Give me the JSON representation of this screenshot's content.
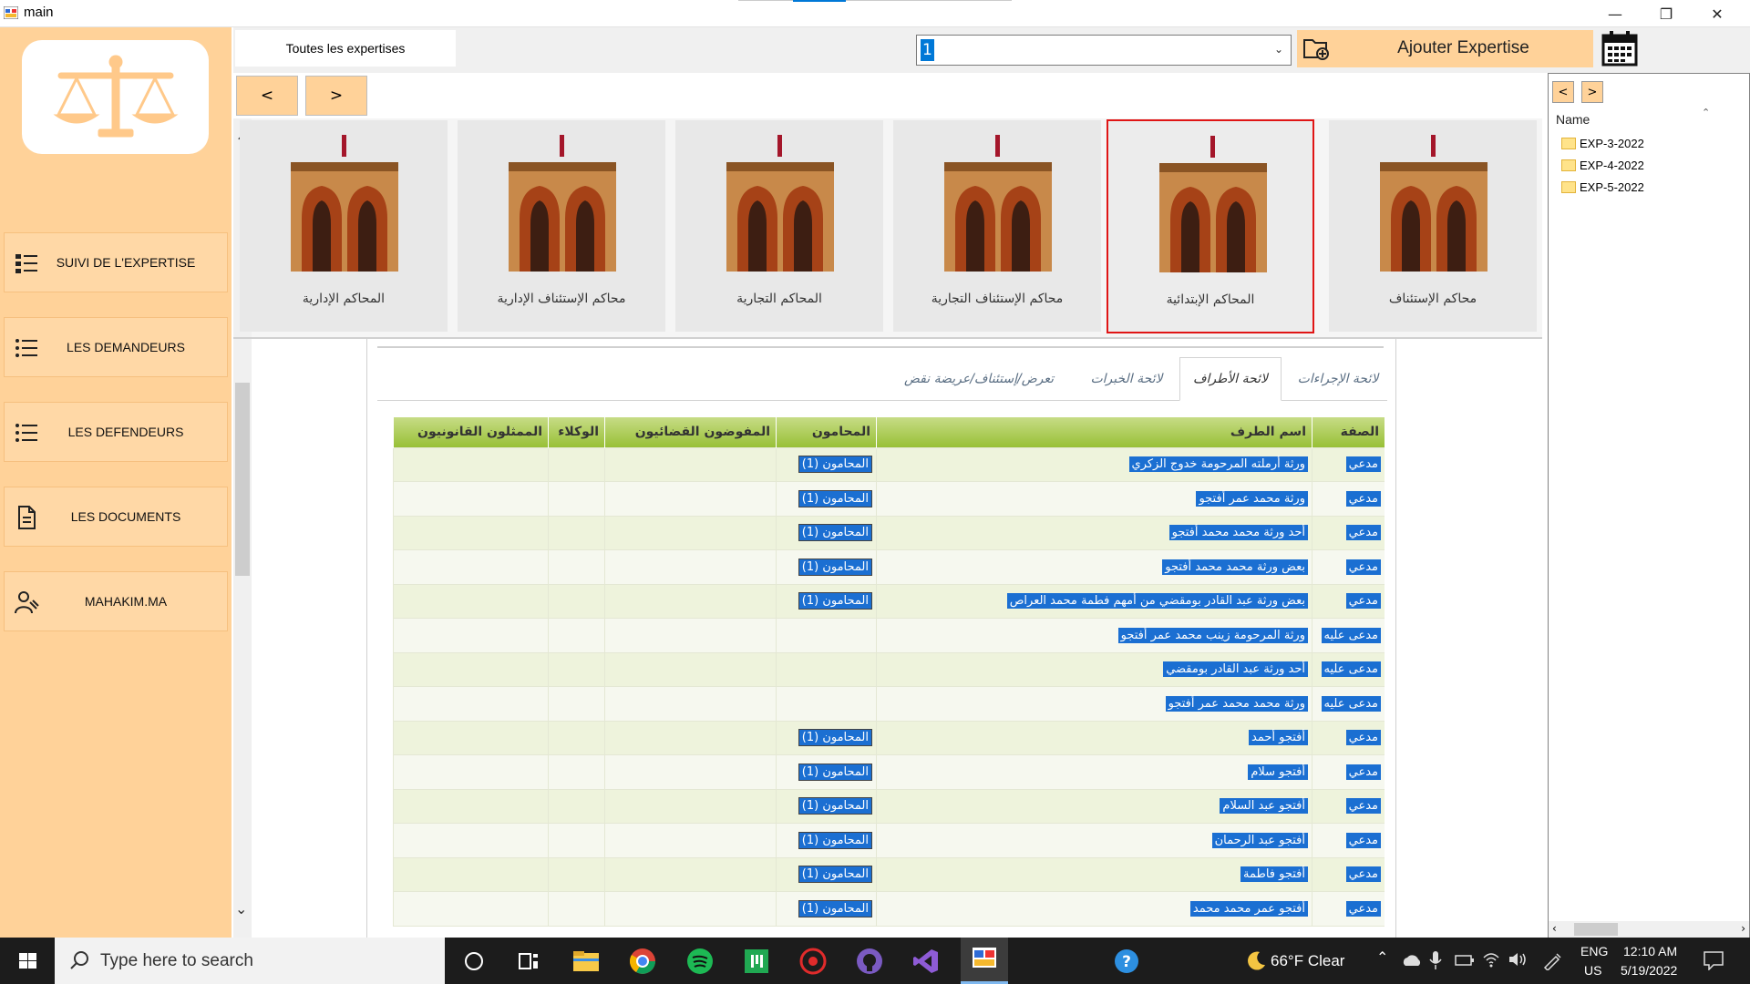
{
  "window": {
    "title": "main"
  },
  "toolbar": {
    "all_expertises_tab": "Toutes les expertises",
    "combo_value": "1",
    "add_button": "Ajouter  Expertise",
    "prev": "<",
    "next": ">"
  },
  "sidebar": {
    "items": [
      {
        "label": "SUIVI DE L'EXPERTISE",
        "icon": "list-bullets-icon"
      },
      {
        "label": "LES DEMANDEURS",
        "icon": "list-icon"
      },
      {
        "label": "LES DEFENDEURS",
        "icon": "list-icon"
      },
      {
        "label": "LES DOCUMENTS",
        "icon": "document-icon"
      },
      {
        "label": "MAHAKIM.MA",
        "icon": "judge-icon"
      }
    ]
  },
  "courts": [
    {
      "label": "المحاكم الإدارية"
    },
    {
      "label": "محاكم الإستئناف الإدارية"
    },
    {
      "label": "المحاكم التجارية"
    },
    {
      "label": "محاكم الإستئناف التجارية"
    },
    {
      "label": "المحاكم الإبتدائية",
      "selected": true
    },
    {
      "label": "محاكم الإستئناف"
    }
  ],
  "tree": {
    "prev": "<",
    "next": ">",
    "header": "Name",
    "items": [
      "EXP-3-2022",
      "EXP-4-2022",
      "EXP-5-2022"
    ]
  },
  "tabs": [
    {
      "label": "لائحة الإجراءات"
    },
    {
      "label": "لائحة الأطراف",
      "active": true
    },
    {
      "label": "لائحة الخبرات"
    },
    {
      "label": "تعرض/إستئناف/عريضة نقض"
    }
  ],
  "grid": {
    "headers": {
      "role": "الصفة",
      "party": "اسم الطرف",
      "lawyers": "المحامون",
      "judicial": "المفوضون القضائيون",
      "agents": "الوكلاء",
      "legal": "الممثلون القانونيون"
    },
    "rows": [
      {
        "role": "مدعي",
        "party": "ورثة أرملته المرحومة خدوج الزكري",
        "lawyers": "المحامون (1)"
      },
      {
        "role": "مدعي",
        "party": "ورثة محمد عمر أفتجو",
        "lawyers": "المحامون (1)"
      },
      {
        "role": "مدعي",
        "party": "أحد ورثة محمد محمد أفتجو",
        "lawyers": "المحامون (1)"
      },
      {
        "role": "مدعي",
        "party": "بعض ورثة محمد محمد أفتجو",
        "lawyers": "المحامون (1)"
      },
      {
        "role": "مدعي",
        "party": "بعض ورثة عبد القادر بومقضي من أمهم فطمة محمد العراص",
        "lawyers": "المحامون (1)"
      },
      {
        "role": "مدعى عليه",
        "party": "ورثة المرحومة زينب محمد عمر أفتجو",
        "lawyers": ""
      },
      {
        "role": "مدعى عليه",
        "party": "أحد ورثة عبد القادر بومقضي",
        "lawyers": ""
      },
      {
        "role": "مدعى عليه",
        "party": "ورثة محمد محمد عمر أفتجو",
        "lawyers": ""
      },
      {
        "role": "مدعي",
        "party": "أفتجو أحمد",
        "lawyers": "المحامون (1)"
      },
      {
        "role": "مدعي",
        "party": "أفتجو سلام",
        "lawyers": "المحامون (1)"
      },
      {
        "role": "مدعي",
        "party": "أفتجو عبد السلام",
        "lawyers": "المحامون (1)"
      },
      {
        "role": "مدعي",
        "party": "أفتجو عبد الرحمان",
        "lawyers": "المحامون (1)"
      },
      {
        "role": "مدعي",
        "party": "أفتجو فاطمة",
        "lawyers": "المحامون (1)"
      },
      {
        "role": "مدعي",
        "party": "أفتجو عمر محمد محمد",
        "lawyers": "المحامون (1)"
      }
    ]
  },
  "taskbar": {
    "search_placeholder": "Type here to search",
    "weather": "66°F  Clear",
    "lang_top": "ENG",
    "lang_bottom": "US",
    "time": "12:10 AM",
    "date": "5/19/2022"
  },
  "colors": {
    "accent_orange": "#ffd299",
    "grid_header_green": "#98c036",
    "selection_blue": "#1b6fd2",
    "selected_court_border": "#e01515"
  }
}
